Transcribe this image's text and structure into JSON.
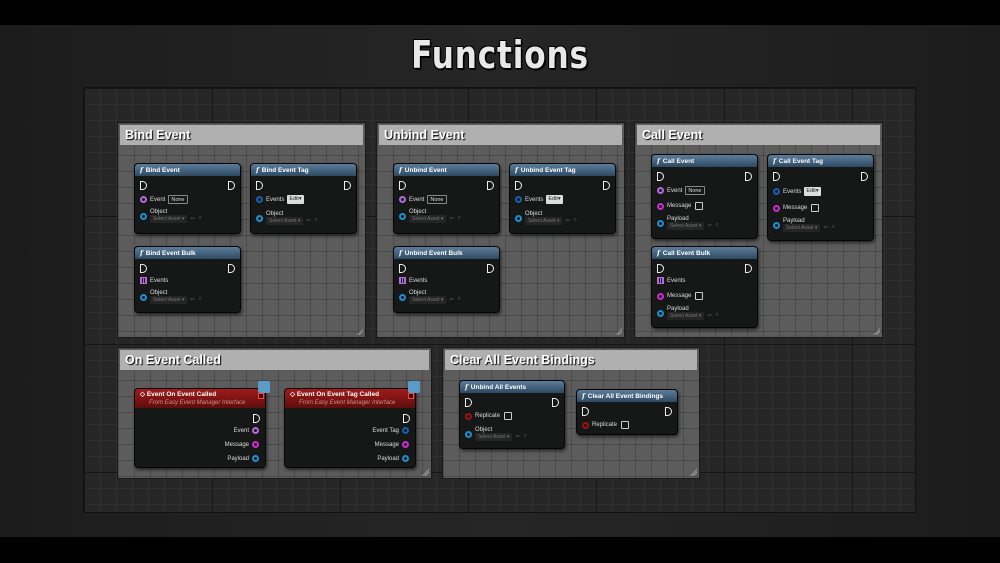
{
  "title": "Functions",
  "colors": {
    "node_header": "#3d6582",
    "event_header": "#8e1515",
    "pin_event": "#b56bdc",
    "pin_message": "#d02ad0",
    "pin_object": "#1e90d0",
    "pin_replicate": "#a01010"
  },
  "groups": [
    {
      "title": "Bind Event",
      "nodes": [
        {
          "title": "Bind Event",
          "event_label": "Event",
          "event_value": "None",
          "object_label": "Object",
          "object_value": "Select Asset"
        },
        {
          "title": "Bind Event Tag",
          "events_label": "Events",
          "events_value": "Edit",
          "object_label": "Object",
          "object_value": "Select Asset"
        },
        {
          "title": "Bind Event Bulk",
          "events_label": "Events",
          "object_label": "Object",
          "object_value": "Select Asset"
        }
      ]
    },
    {
      "title": "Unbind Event",
      "nodes": [
        {
          "title": "Unbind Event",
          "event_label": "Event",
          "event_value": "None",
          "object_label": "Object",
          "object_value": "Select Asset"
        },
        {
          "title": "Unbind Event Tag",
          "events_label": "Events",
          "events_value": "Edit",
          "object_label": "Object",
          "object_value": "Select Asset"
        },
        {
          "title": "Unbind Event Bulk",
          "events_label": "Events",
          "object_label": "Object",
          "object_value": "Select Asset"
        }
      ]
    },
    {
      "title": "Call Event",
      "nodes": [
        {
          "title": "Call Event",
          "event_label": "Event",
          "event_value": "None",
          "message_label": "Message",
          "payload_label": "Payload",
          "payload_value": "Select Asset"
        },
        {
          "title": "Call Event Tag",
          "events_label": "Events",
          "events_value": "Edit",
          "message_label": "Message",
          "payload_label": "Payload",
          "payload_value": "Select Asset"
        },
        {
          "title": "Call Event Bulk",
          "events_label": "Events",
          "message_label": "Message",
          "payload_label": "Payload",
          "payload_value": "Select Asset"
        }
      ]
    },
    {
      "title": "On Event Called",
      "nodes": [
        {
          "title": "Event On Event Called",
          "subtitle": "From Easy Event Manager Interface",
          "out1": "Event",
          "out2": "Message",
          "out3": "Payload"
        },
        {
          "title": "Event On Event Tag Called",
          "subtitle": "From Easy Event Manager Interface",
          "out1": "Event Tag",
          "out2": "Message",
          "out3": "Payload"
        }
      ]
    },
    {
      "title": "Clear All Event Bindings",
      "nodes": [
        {
          "title": "Unbind All Events",
          "replicate_label": "Replicate",
          "object_label": "Object",
          "object_value": "Select Asset"
        },
        {
          "title": "Clear All Event Bindings",
          "replicate_label": "Replicate"
        }
      ]
    }
  ]
}
